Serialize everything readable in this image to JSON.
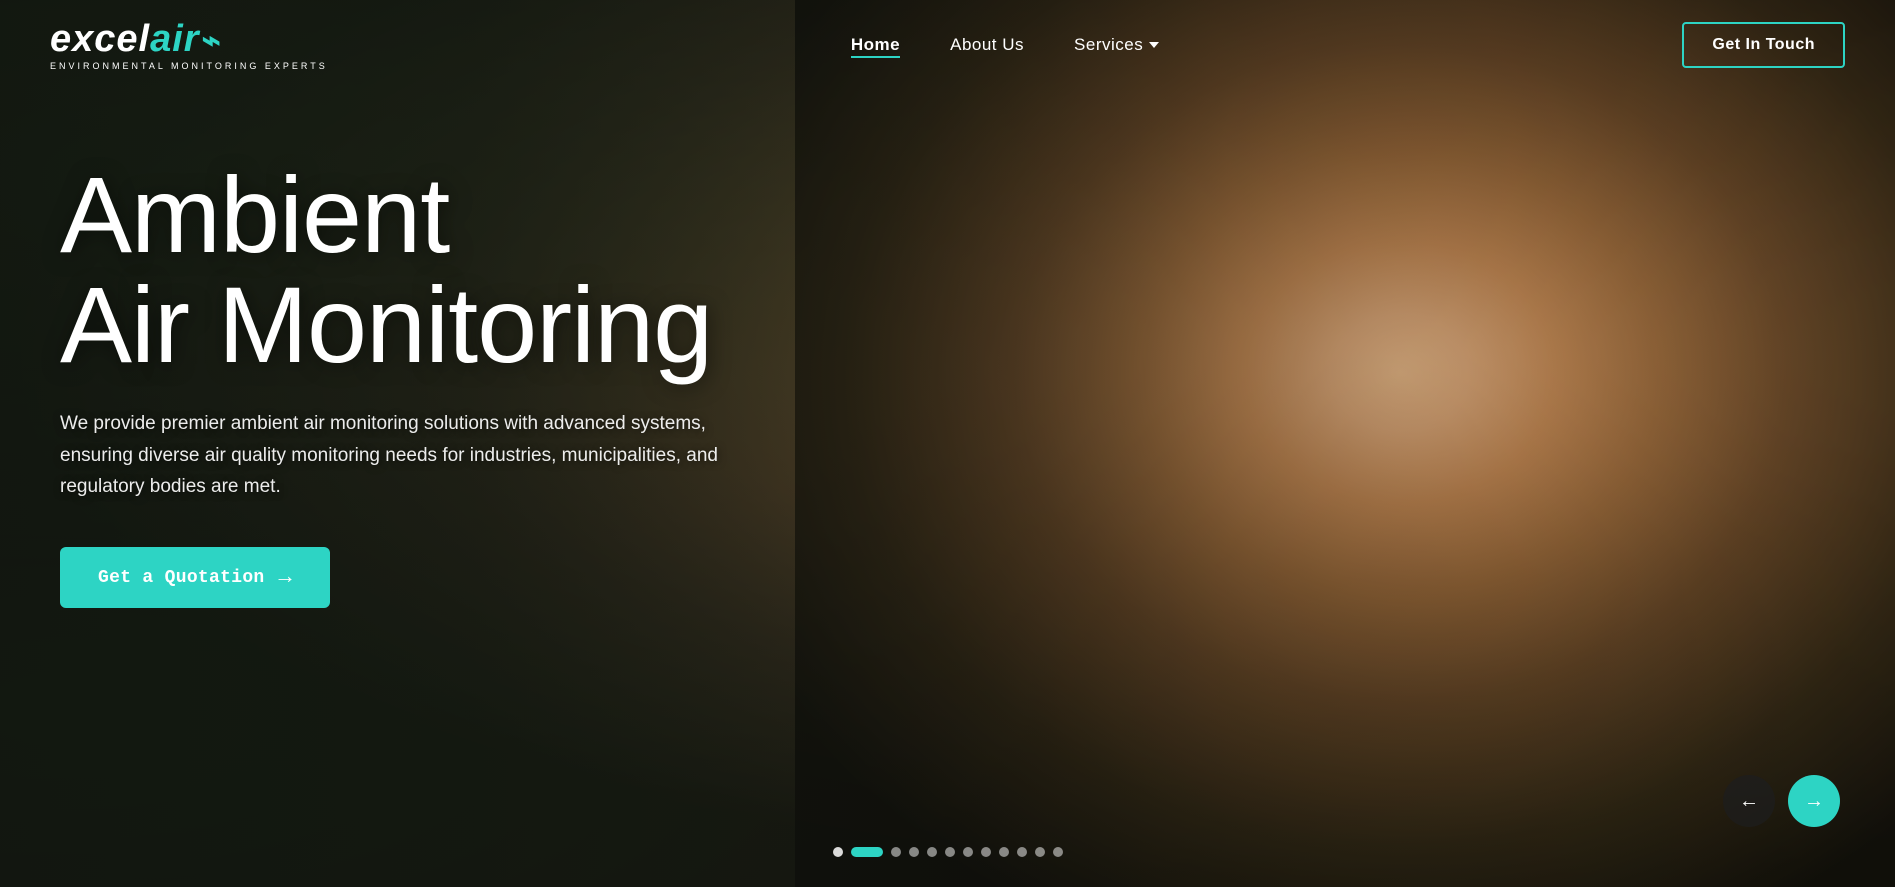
{
  "logo": {
    "excel": "excel",
    "air": "air",
    "subtitle": "ENVIRONMENTAL MONITORING EXPERTS",
    "icon": "≋"
  },
  "nav": {
    "home_label": "Home",
    "about_label": "About Us",
    "services_label": "Services",
    "get_in_touch_label": "Get In Touch"
  },
  "hero": {
    "title_line1": "Ambient",
    "title_line2": "Air Monitoring",
    "description": "We provide premier ambient air monitoring solutions with advanced systems, ensuring diverse air quality monitoring needs for industries, municipalities, and regulatory bodies are met.",
    "cta_label": "Get a Quotation"
  },
  "slider": {
    "prev_icon": "←",
    "next_icon": "→",
    "dots": [
      {
        "id": 1,
        "state": "white"
      },
      {
        "id": 2,
        "state": "active"
      },
      {
        "id": 3,
        "state": "default"
      },
      {
        "id": 4,
        "state": "default"
      },
      {
        "id": 5,
        "state": "default"
      },
      {
        "id": 6,
        "state": "default"
      },
      {
        "id": 7,
        "state": "default"
      },
      {
        "id": 8,
        "state": "default"
      },
      {
        "id": 9,
        "state": "default"
      },
      {
        "id": 10,
        "state": "default"
      },
      {
        "id": 11,
        "state": "default"
      },
      {
        "id": 12,
        "state": "default"
      }
    ]
  },
  "colors": {
    "accent": "#2dd4c4",
    "white": "#ffffff",
    "dark_bg": "#1a1a1a"
  }
}
